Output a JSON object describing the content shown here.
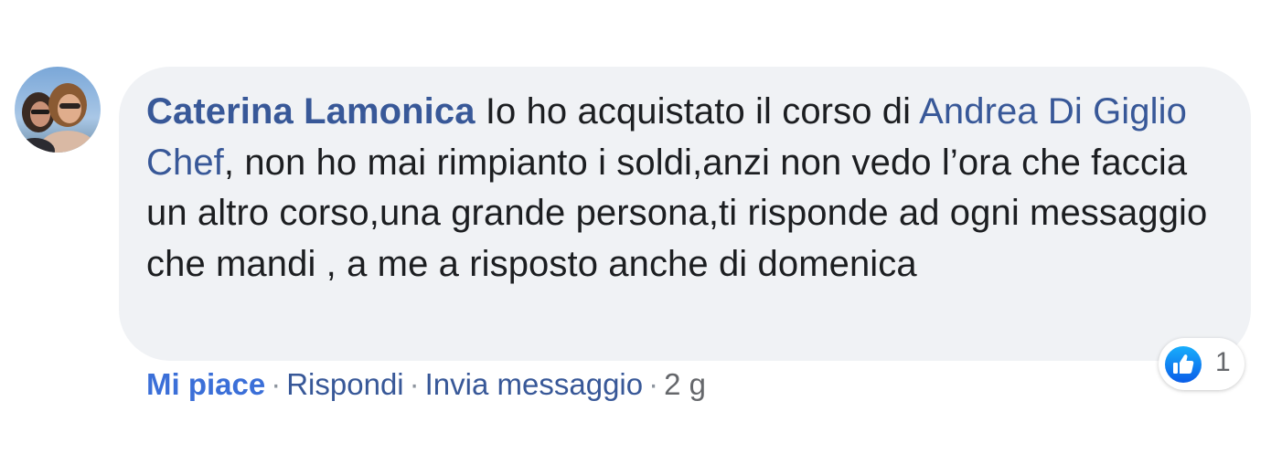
{
  "comment": {
    "author": "Caterina Lamonica",
    "text_before_mention": "Io ho acquistato il corso di",
    "mention": "Andrea Di Giglio Chef",
    "text_after_mention": ", non ho mai rimpianto i soldi,anzi non vedo l’ora che faccia un altro corso,una grande persona,ti risponde ad ogni messaggio che mandi , a me a risposto anche di domenica"
  },
  "reactions": {
    "icon": "like-thumb-icon",
    "count": "1"
  },
  "actions": {
    "like_label": "Mi piace",
    "reply_label": "Rispondi",
    "message_label": "Invia messaggio",
    "separator": "·",
    "time": "2 g"
  },
  "colors": {
    "author": "#385898",
    "bubble_bg": "#f0f2f5",
    "text": "#1c1e21",
    "like_blue": "#1877f2"
  }
}
